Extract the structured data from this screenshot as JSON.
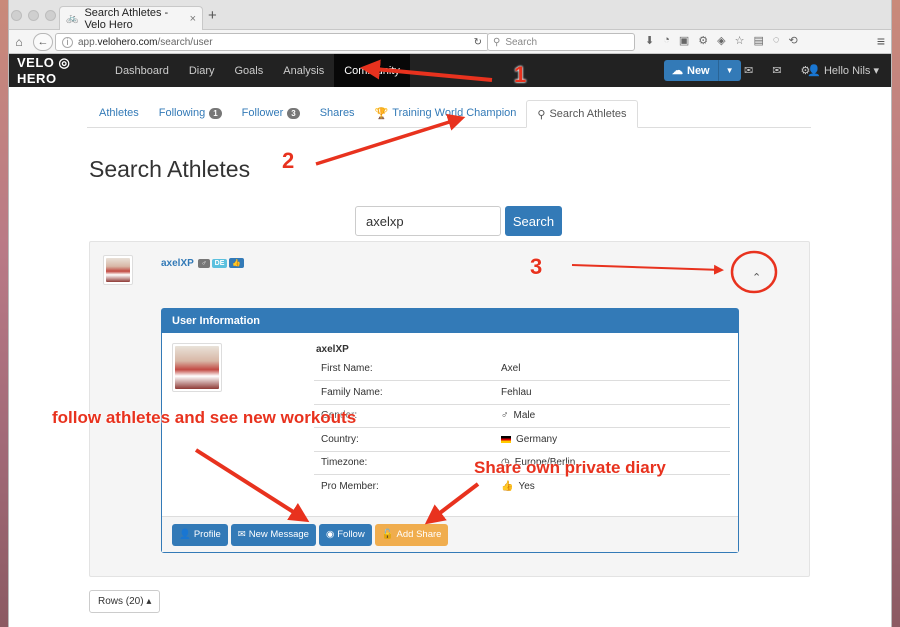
{
  "browser": {
    "tab_title": "Search Athletes - Velo Hero",
    "url_prefix": "app.",
    "url_domain": "velohero.com",
    "url_path": "/search/user",
    "search_placeholder": "Search"
  },
  "app": {
    "brand": "VELO ◎ HERO",
    "nav": [
      "Dashboard",
      "Diary",
      "Goals",
      "Analysis",
      "Community"
    ],
    "new_button": "New",
    "user_menu": "Hello Nils"
  },
  "tabs": {
    "athletes": "Athletes",
    "following": "Following",
    "following_count": "1",
    "follower": "Follower",
    "follower_count": "3",
    "shares": "Shares",
    "champion": "Training World Champion",
    "search": "Search Athletes"
  },
  "page": {
    "title": "Search Athletes",
    "search_value": "axelxp",
    "search_button": "Search",
    "rows_button": "Rows (20)"
  },
  "result": {
    "username": "axelXP",
    "label_country": "DE",
    "colors": {
      "primary": "#337ab7",
      "warning": "#f0ad4e",
      "info": "#5bc0de",
      "default": "#777777"
    }
  },
  "user_info": {
    "header": "User Information",
    "name": "axelXP",
    "fields": [
      {
        "label": "First Name:",
        "value": "Axel"
      },
      {
        "label": "Family Name:",
        "value": "Fehlau"
      },
      {
        "label": "Gender:",
        "value": "Male"
      },
      {
        "label": "Country:",
        "value": "Germany"
      },
      {
        "label": "Timezone:",
        "value": "Europe/Berlin"
      },
      {
        "label": "Pro Member:",
        "value": "Yes"
      }
    ],
    "buttons": {
      "profile": "Profile",
      "message": "New Message",
      "follow": "Follow",
      "share": "Add Share"
    }
  },
  "annotations": {
    "n1": "1",
    "n2": "2",
    "n3": "3",
    "follow_note": "follow athletes and see new workouts",
    "share_note": "Share own private diary",
    "color": "#e8321e"
  }
}
